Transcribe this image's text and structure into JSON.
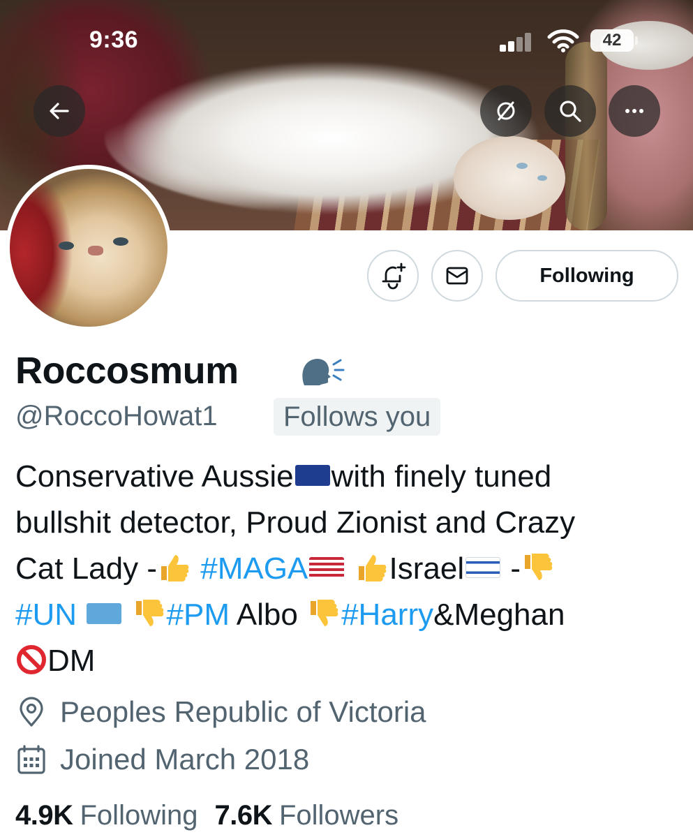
{
  "status_bar": {
    "time": "9:36",
    "battery": "42"
  },
  "header": {
    "back_icon": "back-arrow-icon",
    "translate_icon": "slashed-circle-icon",
    "search_icon": "search-icon",
    "more_icon": "more-icon"
  },
  "actions": {
    "notify_icon": "bell-plus-icon",
    "message_icon": "envelope-icon",
    "following_label": "Following"
  },
  "profile": {
    "display_name": "Roccosmum",
    "handle": "@RoccoHowat1",
    "follows_you": "Follows you",
    "bio": {
      "line1_a": "Conservative Aussie",
      "line1_b": "with finely tuned",
      "line2": "bullshit detector, Proud Zionist and Crazy",
      "line3_a": "Cat Lady -",
      "line3_tag": "#MAGA",
      "line3_b": "Israel",
      "line3_c": " -",
      "line4_tag1": "#UN",
      "line4_tag2": "#PM",
      "line4_a": " Albo ",
      "line4_tag3": "#Harry",
      "line4_b": "&Meghan",
      "line5": "DM"
    },
    "location": "Peoples Republic of Victoria",
    "joined": "Joined March 2018",
    "following_count": "4.9K",
    "following_label": "Following",
    "followers_count": "7.6K",
    "followers_label": "Followers"
  },
  "colors": {
    "link": "#1d9bf0",
    "secondary_text": "#536471",
    "primary_text": "#0f1419",
    "border": "#cfd9de"
  }
}
